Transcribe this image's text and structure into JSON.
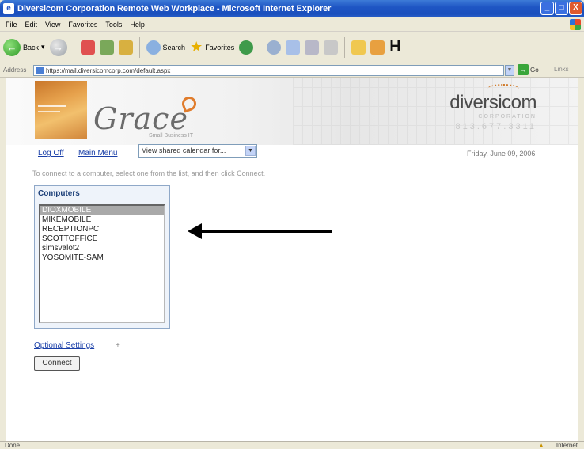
{
  "window": {
    "title": "Diversicom Corporation Remote Web Workplace - Microsoft Internet Explorer",
    "buttons": [
      "_",
      "□",
      "X"
    ]
  },
  "menu": [
    "File",
    "Edit",
    "View",
    "Favorites",
    "Tools",
    "Help"
  ],
  "toolbar": {
    "back_label": "Back",
    "search_label": "Search",
    "favorites_label": "Favorites"
  },
  "address": {
    "label": "Address",
    "url": "https://mail.diversicomcorp.com/default.aspx",
    "go_label": "Go",
    "links_label": "Links"
  },
  "header": {
    "logo_text": "Grace",
    "logo_tagline": "Small Business IT",
    "brand": "diversicom",
    "brand_sub": "CORPORATION",
    "brand_phone": "813.677.3311"
  },
  "nav": {
    "logoff": "Log Off",
    "main_menu": "Main Menu",
    "calendar_select": "View shared calendar for...",
    "date": "Friday, June 09, 2006"
  },
  "main": {
    "instruction": "To connect to a computer, select one from the list, and then click Connect.",
    "computers_heading": "Computers",
    "computers": [
      "DIOXMOBILE",
      "MIKEMOBILE",
      "RECEPTIONPC",
      "SCOTTOFFICE",
      "simsvalot2",
      "YOSOMITE-SAM"
    ],
    "selected_index": 0,
    "optional_settings": "Optional Settings",
    "optional_plus": "+",
    "connect_label": "Connect"
  },
  "status": {
    "left": "Done",
    "zone": "Internet"
  }
}
